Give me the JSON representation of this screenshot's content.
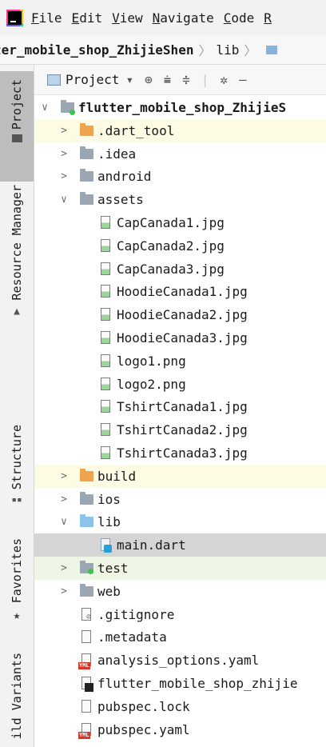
{
  "menubar": {
    "items": [
      {
        "mnemonic": "F",
        "rest": "ile"
      },
      {
        "mnemonic": "E",
        "rest": "dit"
      },
      {
        "mnemonic": "V",
        "rest": "iew"
      },
      {
        "mnemonic": "N",
        "rest": "avigate"
      },
      {
        "mnemonic": "C",
        "rest": "ode"
      },
      {
        "mnemonic": "R",
        "rest": ""
      }
    ]
  },
  "navbar": {
    "project": "ter_mobile_shop_ZhijieShen",
    "crumb": "lib"
  },
  "leftbar": {
    "tabs": [
      "Project",
      "Resource Manager",
      "Structure",
      "Favorites",
      "ild Variants"
    ]
  },
  "panel": {
    "title": "Project"
  },
  "tree": [
    {
      "label": "flutter_mobile_shop_ZhijieS",
      "kind": "root",
      "arrow": "down",
      "bg": "none"
    },
    {
      "label": ".dart_tool",
      "kind": "folder-orange",
      "arrow": "right",
      "bg": "yellow"
    },
    {
      "label": ".idea",
      "kind": "folder-gray",
      "arrow": "right",
      "bg": "none"
    },
    {
      "label": "android",
      "kind": "folder-gray",
      "arrow": "right",
      "bg": "none"
    },
    {
      "label": "assets",
      "kind": "folder-gray",
      "arrow": "down",
      "bg": "none"
    },
    {
      "label": "CapCanada1.jpg",
      "kind": "image",
      "arrow": "",
      "bg": "none"
    },
    {
      "label": "CapCanada2.jpg",
      "kind": "image",
      "arrow": "",
      "bg": "none"
    },
    {
      "label": "CapCanada3.jpg",
      "kind": "image",
      "arrow": "",
      "bg": "none"
    },
    {
      "label": "HoodieCanada1.jpg",
      "kind": "image",
      "arrow": "",
      "bg": "none"
    },
    {
      "label": "HoodieCanada2.jpg",
      "kind": "image",
      "arrow": "",
      "bg": "none"
    },
    {
      "label": "HoodieCanada3.jpg",
      "kind": "image",
      "arrow": "",
      "bg": "none"
    },
    {
      "label": "logo1.png",
      "kind": "image",
      "arrow": "",
      "bg": "none"
    },
    {
      "label": "logo2.png",
      "kind": "image",
      "arrow": "",
      "bg": "none"
    },
    {
      "label": "TshirtCanada1.jpg",
      "kind": "image",
      "arrow": "",
      "bg": "none"
    },
    {
      "label": "TshirtCanada2.jpg",
      "kind": "image",
      "arrow": "",
      "bg": "none"
    },
    {
      "label": "TshirtCanada3.jpg",
      "kind": "image",
      "arrow": "",
      "bg": "none"
    },
    {
      "label": "build",
      "kind": "folder-orange",
      "arrow": "right",
      "bg": "yellow"
    },
    {
      "label": "ios",
      "kind": "folder-gray",
      "arrow": "right",
      "bg": "none"
    },
    {
      "label": "lib",
      "kind": "folder-lblue",
      "arrow": "down",
      "bg": "none"
    },
    {
      "label": "main.dart",
      "kind": "dart",
      "arrow": "",
      "bg": "selected"
    },
    {
      "label": "test",
      "kind": "folder-green",
      "arrow": "right",
      "bg": "green"
    },
    {
      "label": "web",
      "kind": "folder-gray",
      "arrow": "right",
      "bg": "none"
    },
    {
      "label": ".gitignore",
      "kind": "gitignore",
      "arrow": "",
      "bg": "none"
    },
    {
      "label": ".metadata",
      "kind": "text",
      "arrow": "",
      "bg": "none"
    },
    {
      "label": "analysis_options.yaml",
      "kind": "yaml",
      "arrow": "",
      "bg": "none"
    },
    {
      "label": "flutter_mobile_shop_zhijie",
      "kind": "flutter",
      "arrow": "",
      "bg": "none"
    },
    {
      "label": "pubspec.lock",
      "kind": "text",
      "arrow": "",
      "bg": "none"
    },
    {
      "label": "pubspec.yaml",
      "kind": "yaml",
      "arrow": "",
      "bg": "none"
    }
  ]
}
